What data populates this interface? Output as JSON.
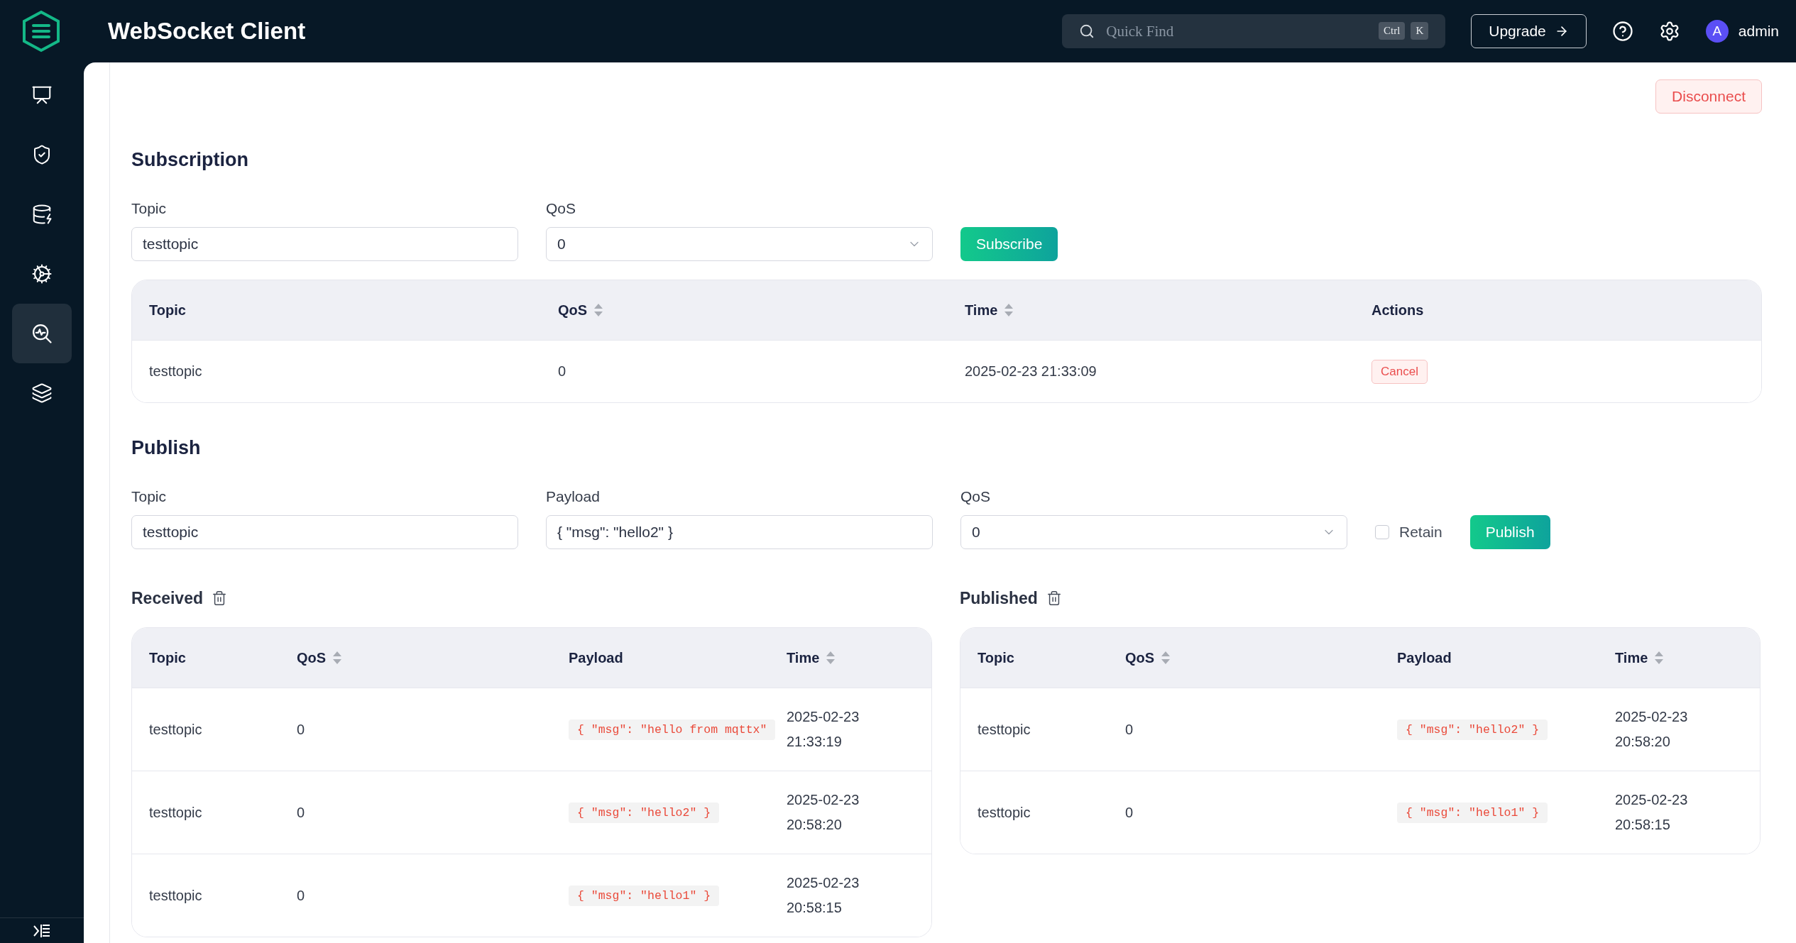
{
  "topbar": {
    "title": "WebSocket Client",
    "search_placeholder": "Quick Find",
    "shortcut_keys": [
      "Ctrl",
      "K"
    ],
    "upgrade": "Upgrade",
    "user": {
      "avatar": "A",
      "name": "admin"
    }
  },
  "sidebar": {
    "items": [
      {
        "selected": false
      },
      {
        "selected": false
      },
      {
        "selected": false
      },
      {
        "selected": false
      },
      {
        "selected": true
      },
      {
        "selected": false
      }
    ]
  },
  "disconnect": "Disconnect",
  "subscription": {
    "title": "Subscription",
    "topic": {
      "label": "Topic",
      "value": "testtopic"
    },
    "qos": {
      "label": "QoS",
      "value": "0"
    },
    "button": "Subscribe",
    "table": {
      "columns": [
        {
          "label": "Topic",
          "sortable": false
        },
        {
          "label": "QoS",
          "sortable": true
        },
        {
          "label": "Time",
          "sortable": true
        },
        {
          "label": "Actions",
          "sortable": false
        }
      ],
      "rows": [
        {
          "topic": "testtopic",
          "qos": "0",
          "time": "2025-02-23 21:33:09",
          "action": "Cancel"
        }
      ]
    }
  },
  "publish": {
    "title": "Publish",
    "topic": {
      "label": "Topic",
      "value": "testtopic"
    },
    "payload": {
      "label": "Payload",
      "value": "{ \"msg\": \"hello2\" }"
    },
    "qos": {
      "label": "QoS",
      "value": "0"
    },
    "retain": {
      "label": "Retain",
      "checked": false
    },
    "button": "Publish"
  },
  "received": {
    "title": "Received",
    "table": {
      "columns": [
        {
          "label": "Topic",
          "sortable": false
        },
        {
          "label": "QoS",
          "sortable": true
        },
        {
          "label": "Payload",
          "sortable": false
        },
        {
          "label": "Time",
          "sortable": true
        }
      ],
      "rows": [
        {
          "topic": "testtopic",
          "qos": "0",
          "payload": "{ \"msg\": \"hello from mqttx\"",
          "time": "2025-02-23 21:33:19"
        },
        {
          "topic": "testtopic",
          "qos": "0",
          "payload": "{ \"msg\": \"hello2\" }",
          "time": "2025-02-23 20:58:20"
        },
        {
          "topic": "testtopic",
          "qos": "0",
          "payload": "{ \"msg\": \"hello1\" }",
          "time": "2025-02-23 20:58:15"
        }
      ]
    }
  },
  "published": {
    "title": "Published",
    "table": {
      "columns": [
        {
          "label": "Topic",
          "sortable": false
        },
        {
          "label": "QoS",
          "sortable": true
        },
        {
          "label": "Payload",
          "sortable": false
        },
        {
          "label": "Time",
          "sortable": true
        }
      ],
      "rows": [
        {
          "topic": "testtopic",
          "qos": "0",
          "payload": "{ \"msg\": \"hello2\" }",
          "time": "2025-02-23 20:58:20"
        },
        {
          "topic": "testtopic",
          "qos": "0",
          "payload": "{ \"msg\": \"hello1\" }",
          "time": "2025-02-23 20:58:15"
        }
      ]
    }
  }
}
